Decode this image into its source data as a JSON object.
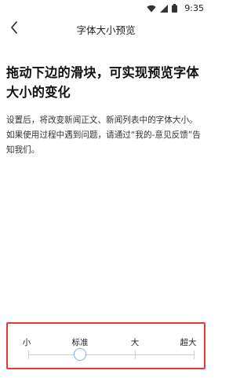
{
  "status_bar": {
    "time": "9:35",
    "icons": [
      "wifi-icon",
      "signal-icon",
      "battery-icon"
    ]
  },
  "title_bar": {
    "back_icon": "chevron-left-icon",
    "title": "字体大小预览"
  },
  "content": {
    "headline": "拖动下边的滑块，可实现预览字体大小的变化",
    "description": "设置后，将改变新闻正文、新闻列表中的字体大小。如果使用过程中遇到问题，请通过“我的-意见反馈”告知我们。"
  },
  "font_size_slider": {
    "levels": [
      "小",
      "标准",
      "大",
      "超大"
    ],
    "selected": "标准",
    "selected_index": 1,
    "highlight_color": "#e53935",
    "thumb_border_color": "#8ab4ea"
  }
}
